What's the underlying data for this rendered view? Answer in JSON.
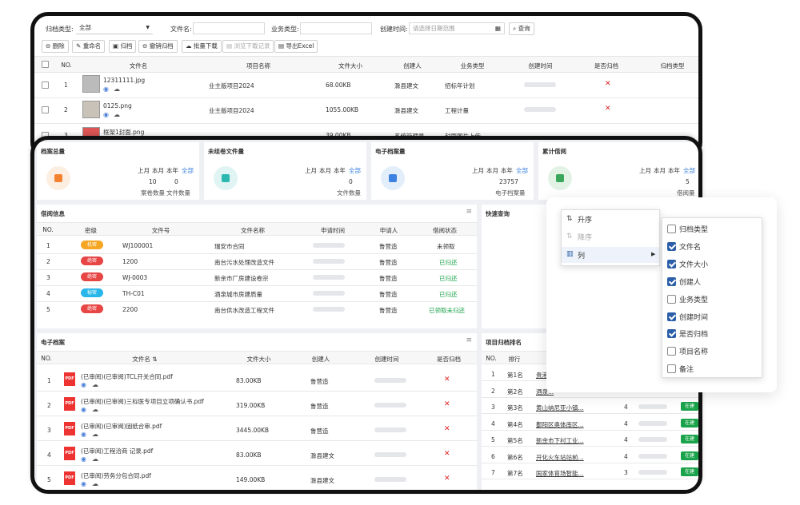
{
  "archive": {
    "filters": {
      "type_label": "归档类型:",
      "type_value": "全部",
      "filename_label": "文件名:",
      "business_label": "业务类型:",
      "created_label": "创建时间:",
      "date_placeholder": "请选择日期范围",
      "search_btn": "查询"
    },
    "toolbar": [
      "删除",
      "重命名",
      "归档",
      "撤销归档",
      "批量下载",
      "浏览下载记录",
      "导出Excel"
    ],
    "columns": [
      "NO.",
      "文件名",
      "项目名称",
      "文件大小",
      "创建人",
      "业务类型",
      "创建时间",
      "是否归档",
      "归档类型"
    ],
    "rows": [
      {
        "no": "1",
        "name": "12311111.jpg",
        "project": "业主版项目2024",
        "size": "68.00KB",
        "creator": "滁县建文",
        "btype": "招标年计划"
      },
      {
        "no": "2",
        "name": "0125.png",
        "project": "业主版项目2024",
        "size": "1055.00KB",
        "creator": "滁县建文",
        "btype": "工程计量"
      },
      {
        "no": "3",
        "name": "框架1封面.png",
        "project": "",
        "size": "39.00KB",
        "creator": "系统管理员",
        "btype": "封面图片上传"
      }
    ]
  },
  "dashboard": {
    "stats": [
      {
        "title": "档案总量",
        "periods": [
          "上月",
          "本月",
          "本年",
          "全部"
        ],
        "values": [
          "10",
          "0"
        ],
        "captions": [
          "案卷数量",
          "文件数量"
        ],
        "color": "#f2822f",
        "bg": "#fdeee2"
      },
      {
        "title": "未组卷文件量",
        "periods": [
          "上月",
          "本月",
          "本年",
          "全部"
        ],
        "values": [
          "0"
        ],
        "captions": [
          "文件数量"
        ],
        "color": "#2cb8b0",
        "bg": "#e0f4f3"
      },
      {
        "title": "电子档案量",
        "periods": [
          "上月",
          "本月",
          "本年",
          "全部"
        ],
        "values": [
          "23757"
        ],
        "captions": [
          "电子档案量"
        ],
        "color": "#3c82e0",
        "bg": "#e3eefb"
      },
      {
        "title": "累计借阅",
        "periods": [
          "上月",
          "本月",
          "本年",
          "全部"
        ],
        "values": [
          "5"
        ],
        "captions": [
          "借阅量"
        ],
        "color": "#3aa65a",
        "bg": "#e2f3e6"
      }
    ],
    "borrow": {
      "title": "借阅信息",
      "columns": [
        "NO.",
        "密级",
        "文件号",
        "文件名称",
        "申请时间",
        "申请人",
        "借阅状态"
      ],
      "rows": [
        {
          "no": "1",
          "level": "机密",
          "lcolor": "#f5a623",
          "code": "WJ100001",
          "name": "瑞安市合同",
          "person": "鲁营造",
          "status": "未领取",
          "scls": ""
        },
        {
          "no": "2",
          "level": "绝密",
          "lcolor": "#e84545",
          "code": "1200",
          "name": "南台污水处理改造文件",
          "person": "鲁营造",
          "status": "已归还",
          "scls": "green"
        },
        {
          "no": "3",
          "level": "绝密",
          "lcolor": "#e84545",
          "code": "WJ-0003",
          "name": "新余市厂房建设卷宗",
          "person": "鲁营造",
          "status": "已归还",
          "scls": "green"
        },
        {
          "no": "4",
          "level": "秘密",
          "lcolor": "#29b6e8",
          "code": "TH-C01",
          "name": "酒泉城市房建质量",
          "person": "鲁营造",
          "status": "已归还",
          "scls": "green"
        },
        {
          "no": "5",
          "level": "绝密",
          "lcolor": "#e84545",
          "code": "2200",
          "name": "南台供水改造工程文件",
          "person": "鲁营造",
          "status": "已领取未归还",
          "scls": "green"
        }
      ]
    },
    "quick_title": "快速查询",
    "efiles": {
      "title": "电子档案",
      "columns": [
        "NO.",
        "文件名 ⇅",
        "文件大小",
        "创建人",
        "创建时间",
        "是否归档"
      ],
      "rows": [
        {
          "no": "1",
          "name": "(已审阅)(已审阅)TCL开关合同.pdf",
          "size": "83.00KB",
          "creator": "鲁营造"
        },
        {
          "no": "2",
          "name": "(已审阅)(已审阅)三标医专项目立项确认书.pdf",
          "size": "319.00KB",
          "creator": "鲁营造"
        },
        {
          "no": "3",
          "name": "(已审阅)(已审阅)固纸合审.pdf",
          "size": "3445.00KB",
          "creator": "鲁营造"
        },
        {
          "no": "4",
          "name": "(已审阅)工程洽商 记录.pdf",
          "size": "83.00KB",
          "creator": "滁县建文"
        },
        {
          "no": "5",
          "name": "(已审阅)劳务分包合同.pdf",
          "size": "149.00KB",
          "creator": "滁县建文"
        }
      ]
    },
    "ranking": {
      "title": "项目归档排名",
      "columns": [
        "NO.",
        "排行"
      ],
      "rows": [
        {
          "no": "1",
          "rank": "第1名",
          "name": "贵港...",
          "count": "",
          "tag": ""
        },
        {
          "no": "2",
          "rank": "第2名",
          "name": "酒泉...",
          "count": "",
          "tag": ""
        },
        {
          "no": "3",
          "rank": "第3名",
          "name": "黄山纳尼亚小镇...",
          "count": "4",
          "tag": "在建"
        },
        {
          "no": "4",
          "rank": "第4名",
          "name": "鄱阳区奥体南区...",
          "count": "4",
          "tag": "在建"
        },
        {
          "no": "5",
          "rank": "第5名",
          "name": "新余市下村工业...",
          "count": "4",
          "tag": "在建"
        },
        {
          "no": "6",
          "rank": "第6名",
          "name": "开化火车站站前...",
          "count": "4",
          "tag": "在建"
        },
        {
          "no": "7",
          "rank": "第7名",
          "name": "国家体育场智能...",
          "count": "3",
          "tag": "在建"
        }
      ]
    }
  },
  "context_menu": {
    "items": [
      "升序",
      "降序",
      "列"
    ],
    "columns": [
      {
        "label": "归档类型",
        "checked": false
      },
      {
        "label": "文件名",
        "checked": true
      },
      {
        "label": "文件大小",
        "checked": true
      },
      {
        "label": "创建人",
        "checked": true
      },
      {
        "label": "业务类型",
        "checked": false
      },
      {
        "label": "创建时间",
        "checked": true
      },
      {
        "label": "是否归档",
        "checked": true
      },
      {
        "label": "项目名称",
        "checked": false
      },
      {
        "label": "备注",
        "checked": false
      }
    ]
  }
}
